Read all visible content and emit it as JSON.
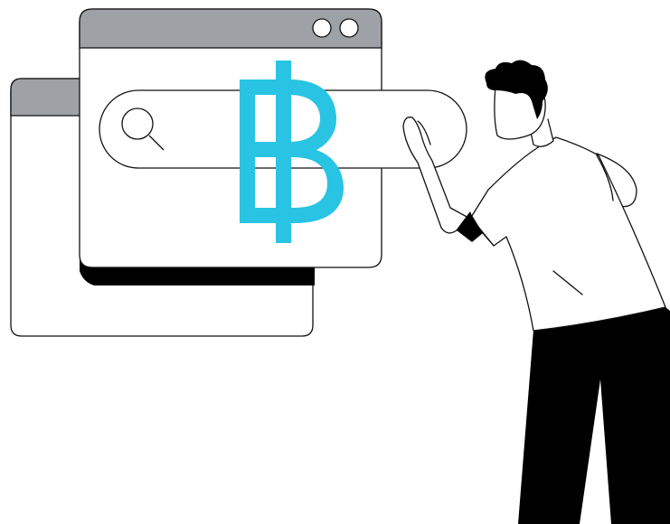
{
  "illustration": {
    "currency_symbol": "฿",
    "icons": [
      "search-icon",
      "baht-icon"
    ],
    "colors": {
      "window_titlebar": "#9ea1a6",
      "outline": "#111111",
      "accent": "#29c4e3",
      "pants": "#000000",
      "hair": "#000000"
    }
  }
}
